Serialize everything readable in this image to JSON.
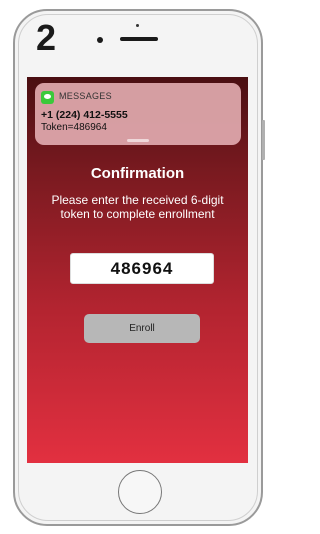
{
  "step_number": "2",
  "notification": {
    "app": "MESSAGES",
    "sender": "+1 (224) 412-5555",
    "body": "Token=486964",
    "icon": "messages-icon"
  },
  "screen": {
    "title": "Confirmation",
    "subtitle": "Please enter the received 6-digit token to complete enrollment",
    "token_value": "486964",
    "enroll_label": "Enroll"
  },
  "colors": {
    "screen_top": "#4a0f12",
    "screen_bottom": "#e23040",
    "button": "#b7b7b7",
    "messages_green": "#3bc93b"
  }
}
